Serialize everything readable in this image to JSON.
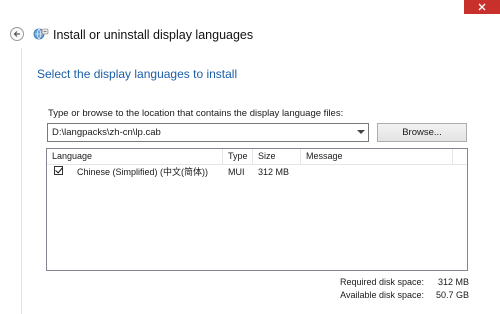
{
  "window": {
    "title": "Install or uninstall display languages",
    "icons": {
      "close": "close-icon",
      "back": "back-arrow-icon",
      "app": "language-globe-icon"
    }
  },
  "page": {
    "heading": "Select the display languages to install",
    "path_label": "Type or browse to the location that contains the display language files:",
    "path_value": "D:\\langpacks\\zh-cn\\lp.cab",
    "browse_label": "Browse..."
  },
  "languages": {
    "columns": [
      "Language",
      "Type",
      "Size",
      "Message"
    ],
    "rows": [
      {
        "checked": true,
        "language": "Chinese (Simplified) (中文(简体))",
        "type": "MUI",
        "size": "312 MB",
        "message": ""
      }
    ]
  },
  "disk": {
    "required_label": "Required disk space:",
    "required_value": "312 MB",
    "available_label": "Available disk space:",
    "available_value": "50.7 GB"
  },
  "colors": {
    "heading": "#1b5ea6",
    "close_button": "#c7302b"
  }
}
